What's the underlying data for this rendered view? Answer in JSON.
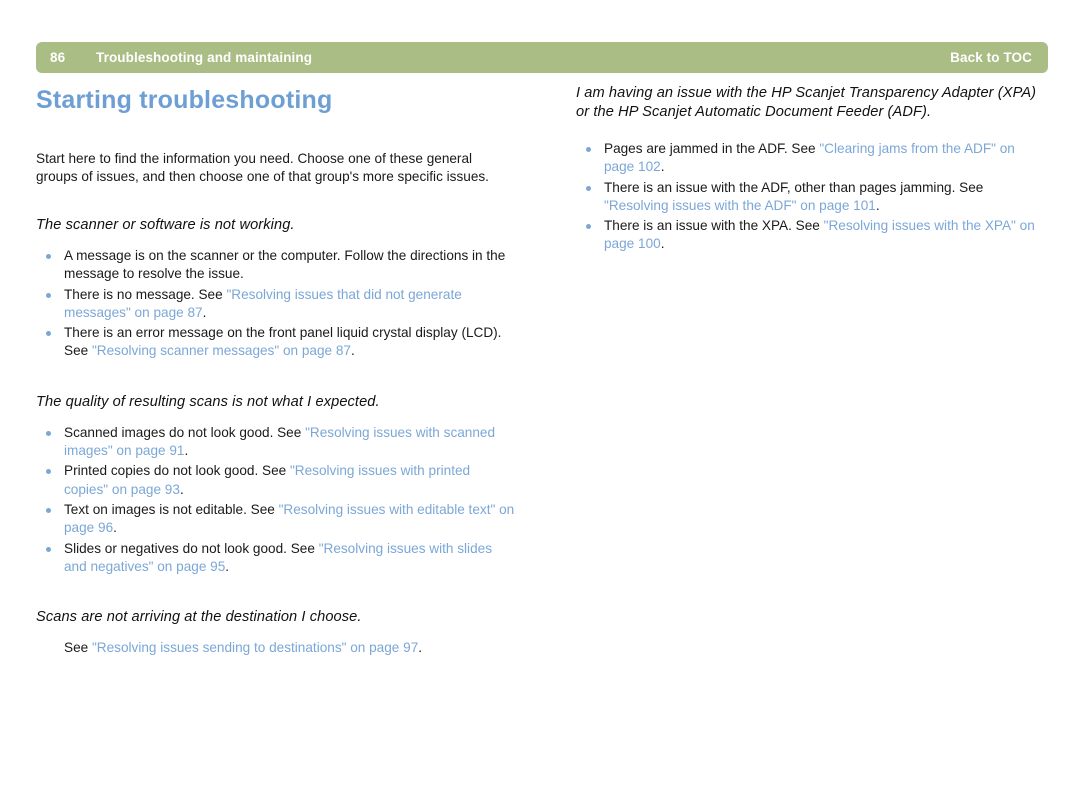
{
  "header": {
    "page_number": "86",
    "chapter": "Troubleshooting and maintaining",
    "toc_link": "Back to TOC",
    "bar_color": "#a9bd84",
    "text_color": "#ffffff"
  },
  "colors": {
    "title_blue": "#6d9ed4",
    "link_blue": "#7ba7d7",
    "body_black": "#1a1a1a",
    "background": "#ffffff"
  },
  "left_column": {
    "title": "Starting troubleshooting",
    "intro": "Start here to find the information you need. Choose one of these general groups of issues, and then choose one of that group's more specific issues.",
    "sections": [
      {
        "heading": "The scanner or software is not working.",
        "bullets": [
          {
            "pre": "A message is on the scanner or the computer. Follow the directions in the message to resolve the issue.",
            "link": "",
            "post": ""
          },
          {
            "pre": "There is no message. See ",
            "link": "\"Resolving issues that did not generate messages\" on page 87",
            "post": "."
          },
          {
            "pre": "There is an error message on the front panel liquid crystal display (LCD). See ",
            "link": "\"Resolving scanner messages\" on page 87",
            "post": "."
          }
        ]
      },
      {
        "heading": "The quality of resulting scans is not what I expected.",
        "bullets": [
          {
            "pre": "Scanned images do not look good. See ",
            "link": "\"Resolving issues with scanned images\" on page 91",
            "post": "."
          },
          {
            "pre": "Printed copies do not look good. See ",
            "link": "\"Resolving issues with printed copies\" on page 93",
            "post": "."
          },
          {
            "pre": "Text on images is not editable. See ",
            "link": "\"Resolving issues with editable text\" on page 96",
            "post": "."
          },
          {
            "pre": "Slides or negatives do not look good. See ",
            "link": "\"Resolving issues with slides and negatives\" on page 95",
            "post": "."
          }
        ]
      },
      {
        "heading": "Scans are not arriving at the destination I choose.",
        "see_line": {
          "pre": "See ",
          "link": "\"Resolving issues sending to destinations\" on page 97",
          "post": "."
        }
      }
    ]
  },
  "right_column": {
    "heading": "I am having an issue with the HP Scanjet Transparency Adapter (XPA) or the HP Scanjet Automatic Document Feeder (ADF).",
    "bullets": [
      {
        "pre": "Pages are jammed in the ADF. See ",
        "link": "\"Clearing jams from the ADF\" on page 102",
        "post": "."
      },
      {
        "pre": "There is an issue with the ADF, other than pages jamming. See ",
        "link": "\"Resolving issues with the ADF\" on page 101",
        "post": "."
      },
      {
        "pre": "There is an issue with the XPA. See ",
        "link": "\"Resolving issues with the XPA\" on page 100",
        "post": "."
      }
    ]
  }
}
